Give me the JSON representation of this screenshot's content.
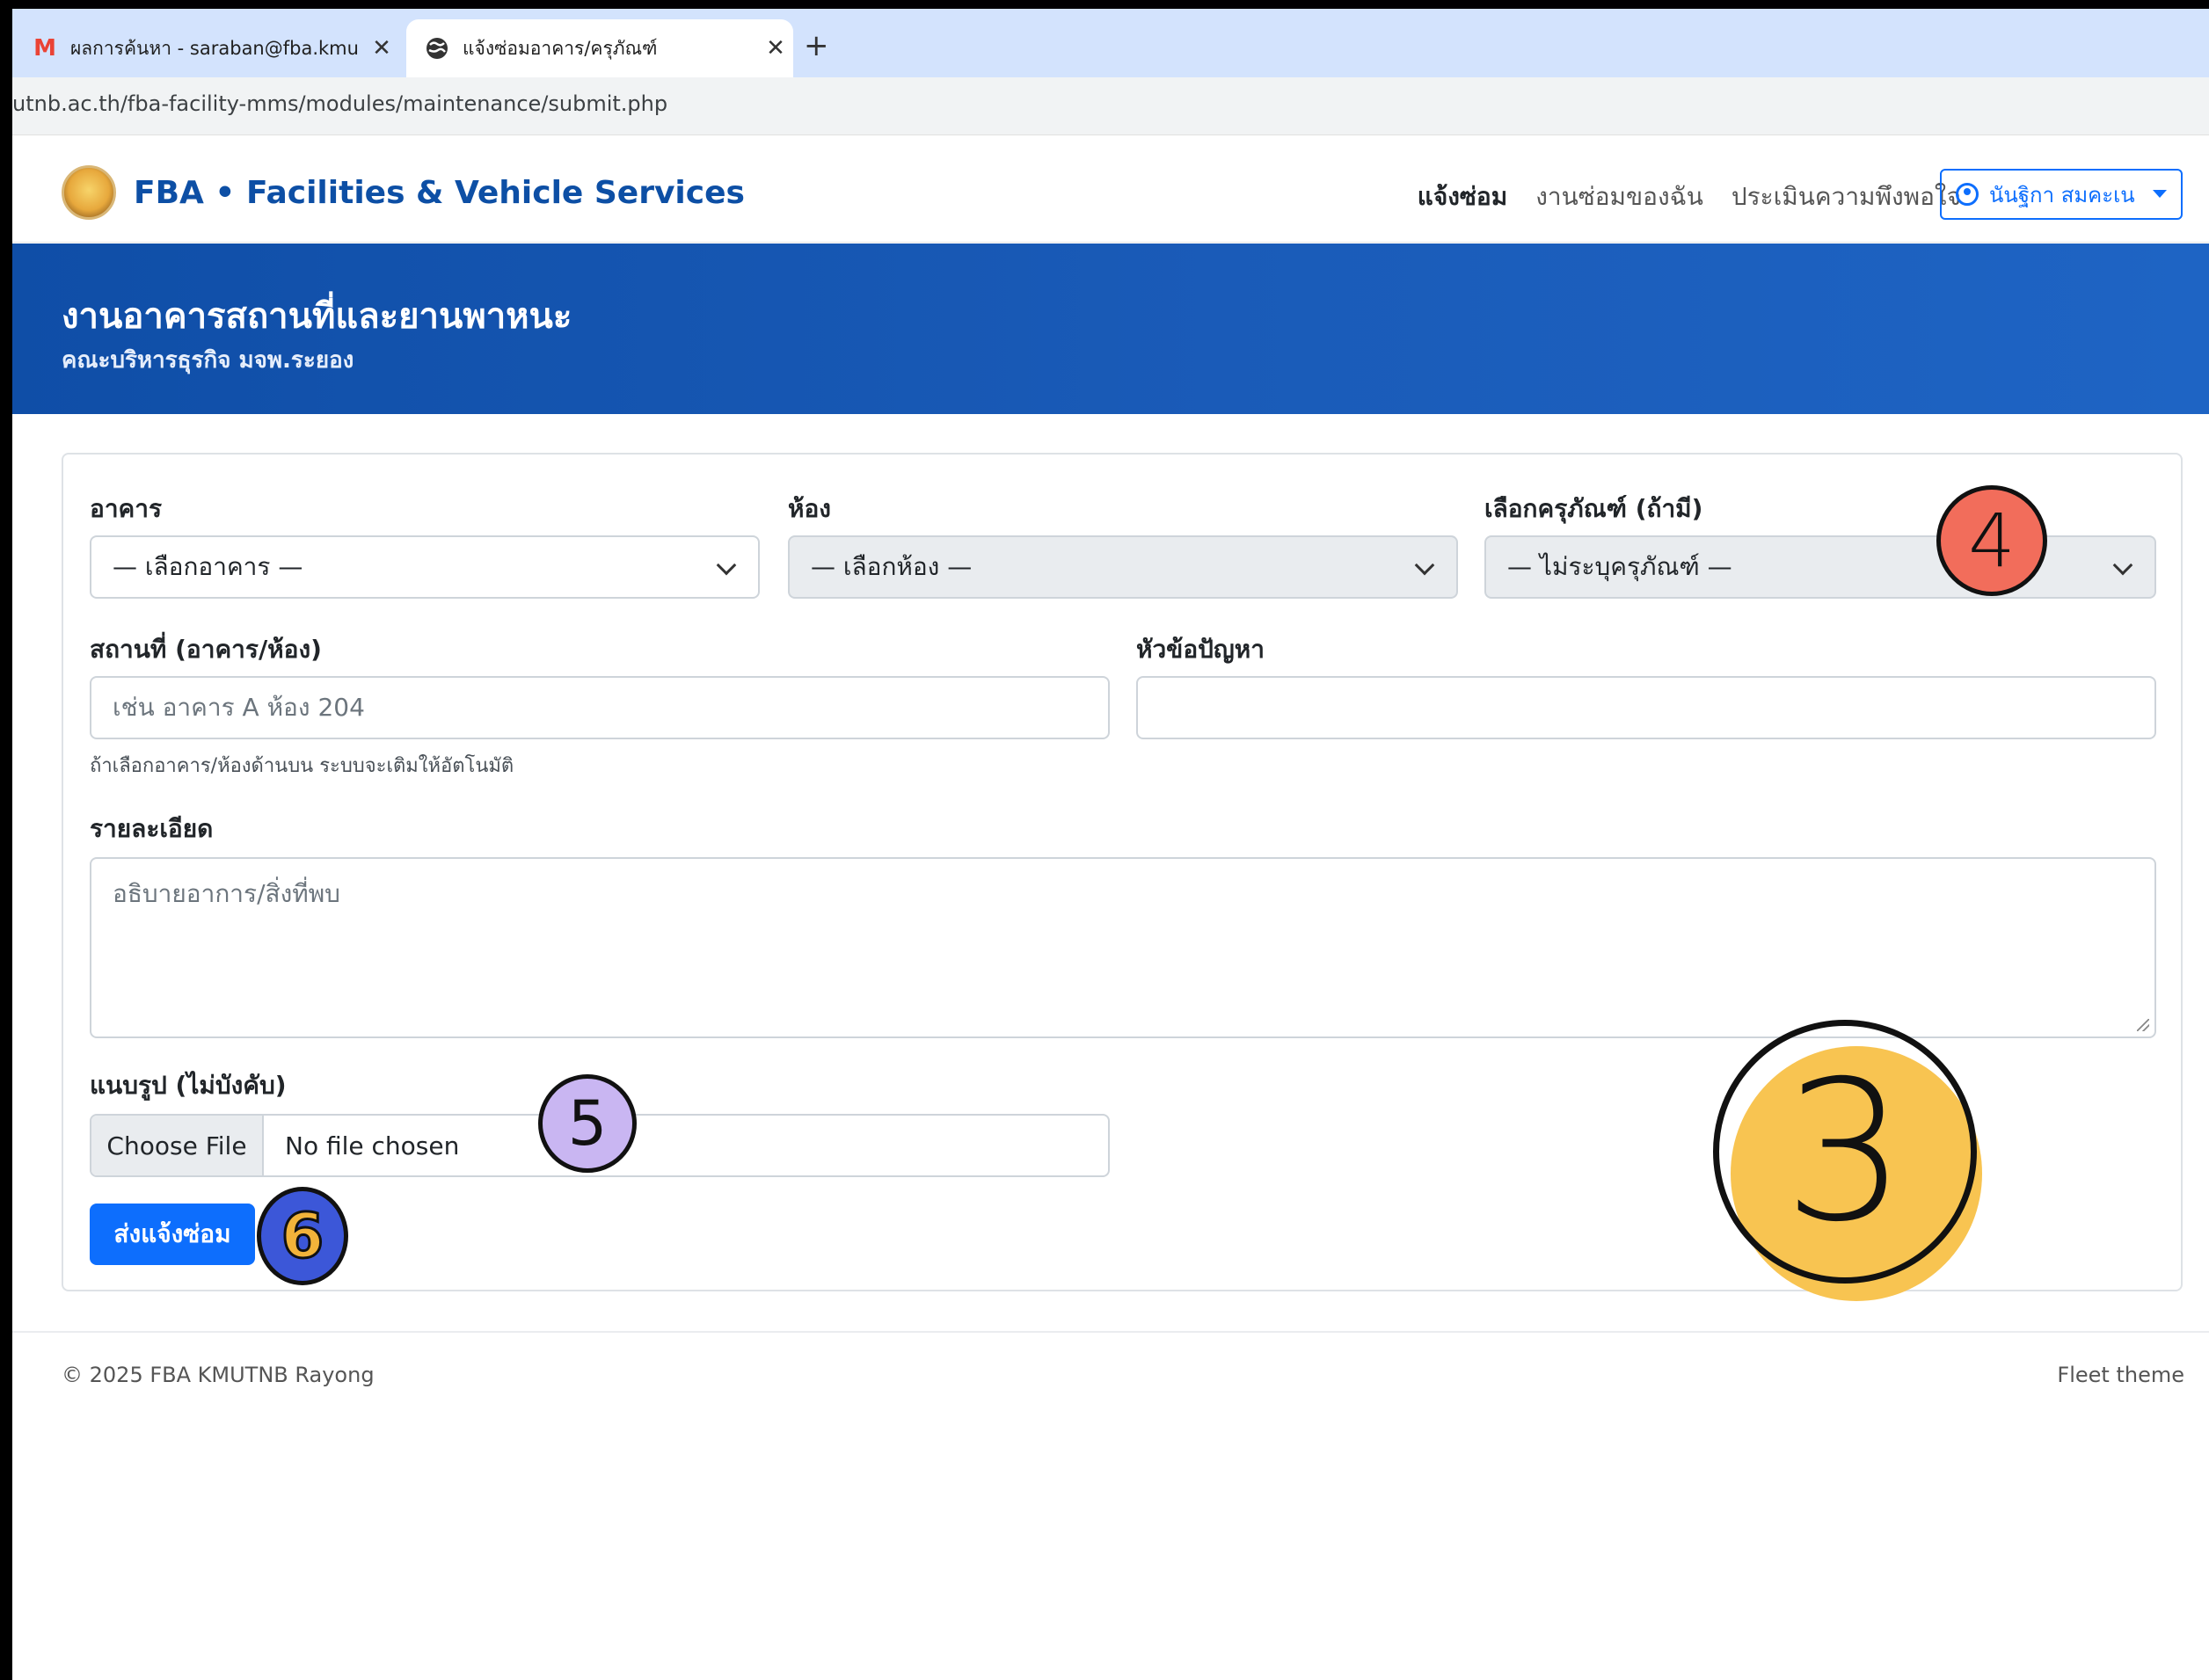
{
  "browser": {
    "tabs": [
      {
        "label": "ผลการค้นหา - saraban@fba.kmu",
        "icon": "gmail-icon",
        "close": "✕"
      },
      {
        "label": "แจ้งซ่อมอาคาร/ครุภัณฑ์",
        "icon": "globe-icon",
        "close": "✕"
      }
    ],
    "new_tab": "+",
    "url": "utnb.ac.th/fba-facility-mms/modules/maintenance/submit.php"
  },
  "navbar": {
    "brand": "FBA • Facilities & Vehicle Services",
    "links": [
      "แจ้งซ่อม",
      "งานซ่อมของฉัน",
      "ประเมินความพึงพอใจ"
    ],
    "user": "นันฐิกา สมคะเน"
  },
  "hero": {
    "title": "งานอาคารสถานที่และยานพาหนะ",
    "subtitle": "คณะบริหารธุรกิจ มจพ.ระยอง"
  },
  "form": {
    "building_label": "อาคาร",
    "building_value": "— เลือกอาคาร —",
    "room_label": "ห้อง",
    "room_value": "— เลือกห้อง —",
    "equipment_label": "เลือกครุภัณฑ์ (ถ้ามี)",
    "equipment_value": "— ไม่ระบุครุภัณฑ์ —",
    "location_label": "สถานที่ (อาคาร/ห้อง)",
    "location_placeholder": "เช่น อาคาร A ห้อง 204",
    "location_hint": "ถ้าเลือกอาคาร/ห้องด้านบน ระบบจะเติมให้อัตโนมัติ",
    "topic_label": "หัวข้อปัญหา",
    "topic_value": "",
    "detail_label": "รายละเอียด",
    "detail_placeholder": "อธิบายอาการ/สิ่งที่พบ",
    "attach_label": "แนบรูป (ไม่บังคับ)",
    "choose_file": "Choose File",
    "no_file": "No file chosen",
    "submit": "ส่งแจ้งซ่อม"
  },
  "footer": {
    "copyright": "© 2025 FBA KMUTNB Rayong",
    "theme": "Fleet theme"
  },
  "annotations": {
    "marker_4": "4",
    "marker_5": "5",
    "marker_6": "6",
    "marker_3": "3"
  },
  "colors": {
    "primary": "#0d6efd",
    "hero": "#1a5bb8",
    "marker_4": "#f26d5b",
    "marker_5": "#c9b6f2",
    "marker_6": "#3c57d8",
    "marker_3": "#f8c451"
  }
}
